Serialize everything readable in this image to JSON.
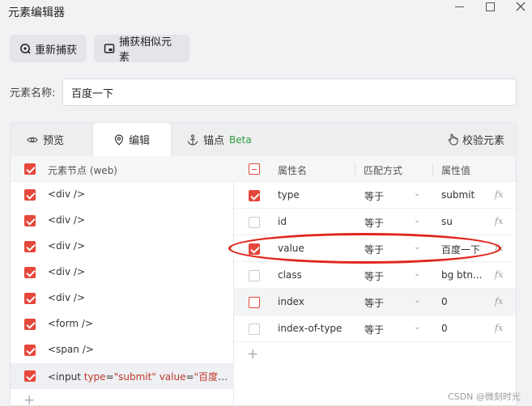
{
  "window": {
    "title": "元素编辑器"
  },
  "toolbar": {
    "recapture_label": "重新捕获",
    "recapture_icon": "recapture-icon",
    "capture_similar_label": "捕获相似元素",
    "capture_similar_icon": "capture-similar-icon"
  },
  "element_name": {
    "label": "元素名称:",
    "value": "百度一下"
  },
  "tabs": [
    {
      "label": "预览",
      "icon": "eye-icon",
      "active": false
    },
    {
      "label": "编辑",
      "icon": "location-pin-icon",
      "active": true
    },
    {
      "label": "锚点",
      "icon": "anchor-icon",
      "active": false,
      "badge": "Beta"
    }
  ],
  "verify": {
    "label": "校验元素",
    "icon": "hand-pointer-icon"
  },
  "nodes": {
    "header": "元素节点 (web)",
    "header_checked": true,
    "items": [
      {
        "text": "<div />",
        "checked": true,
        "selected": false
      },
      {
        "text": "<div />",
        "checked": true,
        "selected": false
      },
      {
        "text": "<div />",
        "checked": true,
        "selected": false
      },
      {
        "text": "<div />",
        "checked": true,
        "selected": false
      },
      {
        "text": "<div />",
        "checked": true,
        "selected": false
      },
      {
        "text": "<form />",
        "checked": true,
        "selected": false
      },
      {
        "text": "<span />",
        "checked": true,
        "selected": false
      },
      {
        "text": "<input type=\"submit\" value=\"百度一…",
        "tag_open": "<input ",
        "attr1_name": "type",
        "attr1_eq": "=",
        "attr1_val": "\"submit\"",
        "attr2_name": "value",
        "attr2_eq": "=",
        "attr2_val": "\"百度一…",
        "checked": true,
        "selected": true
      }
    ],
    "add_icon": "plus-icon"
  },
  "attributes": {
    "header_state": "indeterminate",
    "columns": {
      "name": "属性名",
      "match": "匹配方式",
      "value": "属性值"
    },
    "rows": [
      {
        "name": "type",
        "match": "等于",
        "value": "submit",
        "checked": true
      },
      {
        "name": "id",
        "match": "等于",
        "value": "su",
        "checked": false
      },
      {
        "name": "value",
        "match": "等于",
        "value": "百度一下",
        "checked": true
      },
      {
        "name": "class",
        "match": "等于",
        "value": "bg btn...",
        "checked": false
      },
      {
        "name": "index",
        "match": "等于",
        "value": "0",
        "checked": false
      },
      {
        "name": "index-of-type",
        "match": "等于",
        "value": "0",
        "checked": false
      }
    ],
    "fx_label": "fx",
    "add_icon": "plus-icon"
  },
  "watermark": "CSDN @微刻时光",
  "colors": {
    "accent": "#e5473a",
    "annotation": "#e0251b",
    "beta": "#2e9c3a"
  }
}
